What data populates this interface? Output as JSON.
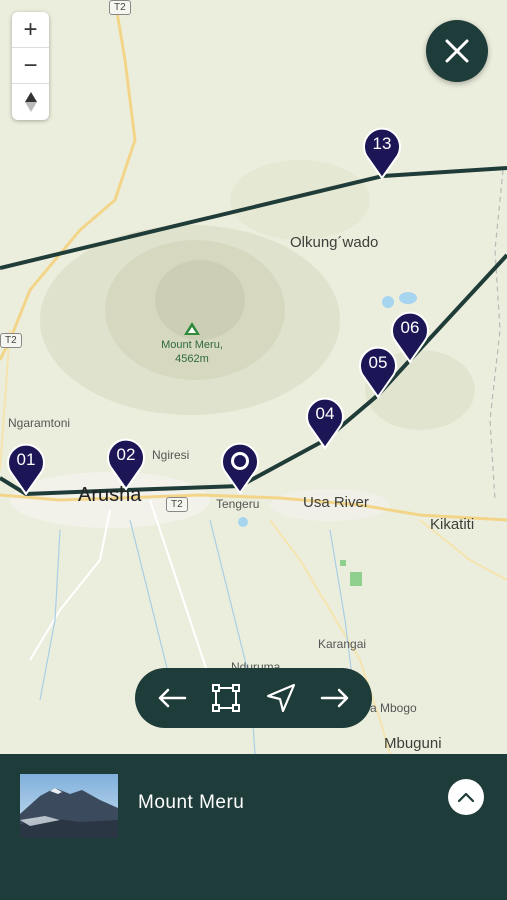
{
  "map": {
    "labels": {
      "olkungwado": "Olkung´wado",
      "mount_meru": "Mount Meru,",
      "mount_meru_elev": "4562m",
      "ngaramtoni": "Ngaramtoni",
      "ngiresi": "Ngiresi",
      "arusha": "Arusha",
      "tengeru": "Tengeru",
      "usa_river": "Usa River",
      "kikatiti": "Kikatiti",
      "karangai": "Karangai",
      "nduruma": "Nduruma",
      "mbogo": "a Mbogo",
      "mbuguni": "Mbuguni"
    },
    "road_shields": [
      "T2",
      "T2",
      "T2"
    ],
    "pins": [
      {
        "label": "01"
      },
      {
        "label": "02"
      },
      {
        "label": ""
      },
      {
        "label": "04"
      },
      {
        "label": "05"
      },
      {
        "label": "06"
      },
      {
        "label": "13"
      }
    ]
  },
  "controls": {
    "zoom_in": "+",
    "zoom_out": "−",
    "compass": "▲"
  },
  "icons": {
    "close": "close-icon",
    "prev": "arrow-left-icon",
    "fit": "fit-bounds-icon",
    "locate": "navigation-arrow-icon",
    "next": "arrow-right-icon",
    "expand": "chevron-up-icon"
  },
  "bottom_panel": {
    "title": "Mount Meru"
  },
  "colors": {
    "accent": "#1e3c39",
    "pin": "#1c1656",
    "route": "#203c38"
  }
}
